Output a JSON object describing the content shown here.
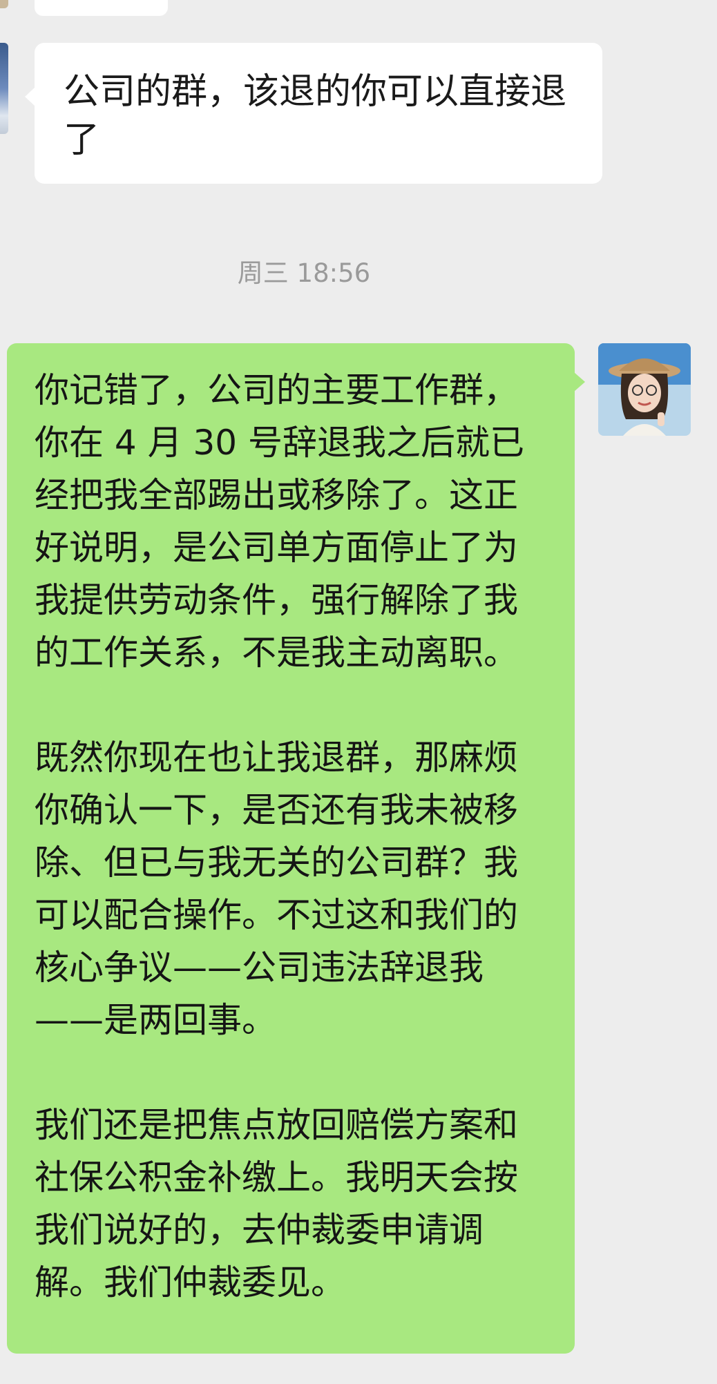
{
  "chat": {
    "incoming_message": "公司的群，该退的你可以直接退了",
    "timestamp": "周三 18:56",
    "outgoing_message": {
      "paragraphs": [
        "你记错了，公司的主要工作群，你在 4 月 30 号辞退我之后就已经把我全部踢出或移除了。这正好说明，是公司单方面停止了为我提供劳动条件，强行解除了我的工作关系，不是我主动离职。",
        "既然你现在也让我退群，那麻烦你确认一下，是否还有我未被移除、但已与我无关的公司群？我可以配合操作。不过这和我们的核心争议——公司违法辞退我——是两回事。",
        "我们还是把焦点放回赔偿方案和社保公积金补缴上。我明天会按我们说好的，去仲裁委申请调解。我们仲裁委见。"
      ]
    }
  },
  "colors": {
    "background": "#ededed",
    "incoming_bubble": "#ffffff",
    "outgoing_bubble": "#a8e880",
    "timestamp_text": "#9a9a9a"
  },
  "icons": {
    "contact_avatar": "contact-avatar-photo",
    "user_avatar": "user-avatar-photo"
  }
}
